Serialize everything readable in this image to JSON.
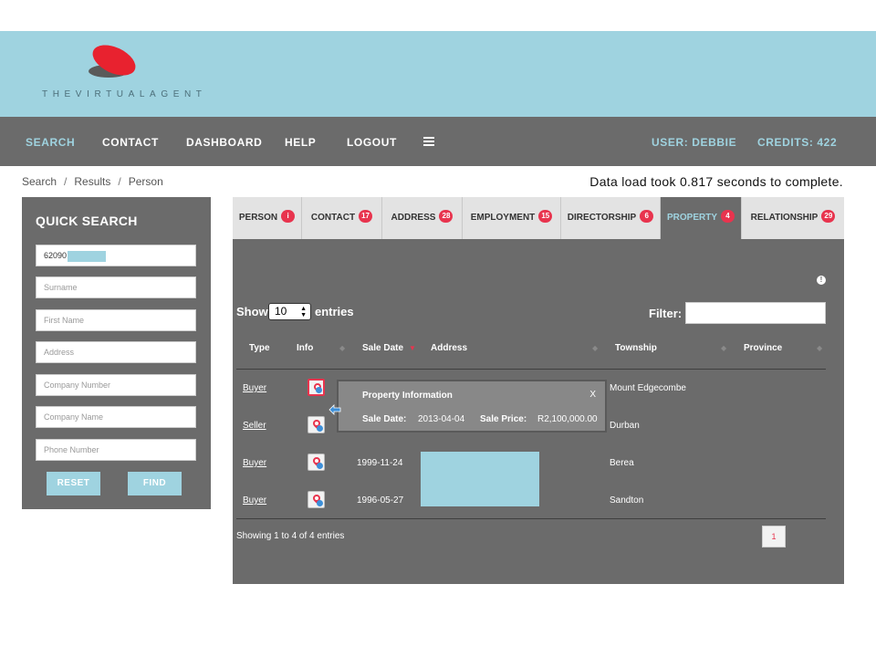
{
  "brand": {
    "logo_text": "THEVIRTUALAGENT"
  },
  "nav": {
    "items": [
      {
        "label": "SEARCH",
        "active": true
      },
      {
        "label": "CONTACT",
        "active": false
      },
      {
        "label": "DASHBOARD",
        "active": false
      },
      {
        "label": "HELP",
        "active": false
      },
      {
        "label": "LOGOUT",
        "active": false
      }
    ],
    "user": "USER: DEBBIE",
    "credits": "CREDITS: 422"
  },
  "breadcrumb": [
    "Search",
    "Results",
    "Person"
  ],
  "status_message": "Data load took 0.817 seconds to complete.",
  "quick_search": {
    "title": "QUICK SEARCH",
    "id_value": "62090",
    "placeholders": [
      "Surname",
      "First Name",
      "Address",
      "Company Number",
      "Company Name",
      "Phone Number"
    ],
    "reset_label": "RESET",
    "find_label": "FIND"
  },
  "tabs": [
    {
      "label": "PERSON",
      "count": "i",
      "active": false
    },
    {
      "label": "CONTACT",
      "count": "17",
      "active": false
    },
    {
      "label": "ADDRESS",
      "count": "28",
      "active": false
    },
    {
      "label": "EMPLOYMENT",
      "count": "15",
      "active": false
    },
    {
      "label": "DIRECTORSHIP",
      "count": "6",
      "active": false
    },
    {
      "label": "PROPERTY",
      "count": "4",
      "active": true
    },
    {
      "label": "RELATIONSHIP",
      "count": "29",
      "active": false
    }
  ],
  "table_controls": {
    "show_label": "Show",
    "page_size": "10",
    "entries_label": "entries",
    "filter_label": "Filter:",
    "help_glyph": "!"
  },
  "table": {
    "columns": [
      "Type",
      "Info",
      "Sale Date",
      "Address",
      "Township",
      "Province"
    ],
    "sorted_column": "Sale Date",
    "rows": [
      {
        "type": "Buyer",
        "sale_date": "",
        "township": "Mount Edgecombe"
      },
      {
        "type": "Seller",
        "sale_date": "",
        "township": "Durban"
      },
      {
        "type": "Buyer",
        "sale_date": "1999-11-24",
        "township": "Berea"
      },
      {
        "type": "Buyer",
        "sale_date": "1996-05-27",
        "township": "Sandton"
      }
    ]
  },
  "popup": {
    "title": "Property Information",
    "close": "X",
    "sale_date_label": "Sale Date:",
    "sale_date": "2013-04-04",
    "sale_price_label": "Sale Price:",
    "sale_price": "R2,100,000.00"
  },
  "footer": {
    "info": "Showing 1 to 4 of 4 entries",
    "current_page": "1"
  },
  "colors": {
    "header_bg": "#9fd3e0",
    "panel_bg": "#6b6b6b",
    "accent": "#9fd3e0",
    "badge": "#e8344e"
  }
}
